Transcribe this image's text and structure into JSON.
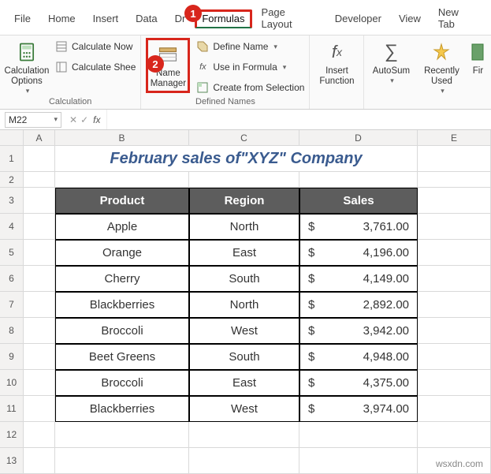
{
  "tabs": {
    "file": "File",
    "home": "Home",
    "insert": "Insert",
    "data": "Data",
    "draw": "Dr",
    "formulas": "Formulas",
    "page_layout": "Page Layout",
    "developer": "Developer",
    "view": "View",
    "new_tab": "New Tab"
  },
  "markers": {
    "m1": "1",
    "m2": "2"
  },
  "ribbon": {
    "calculation": {
      "options": "Calculation Options",
      "calc_now": "Calculate Now",
      "calc_sheet": "Calculate Shee",
      "group": "Calculation"
    },
    "defined_names": {
      "name_manager": "Name Manager",
      "define_name": "Define Name",
      "use_in_formula": "Use in Formula",
      "create_sel": "Create from Selection",
      "group": "Defined Names"
    },
    "insert_function": "Insert Function",
    "autosum": "AutoSum",
    "recently_used": "Recently Used",
    "fin": "Fir"
  },
  "namebox": {
    "ref": "M22",
    "fx": "fx"
  },
  "cols": {
    "A": "A",
    "B": "B",
    "C": "C",
    "D": "D",
    "E": "E"
  },
  "rows": [
    "1",
    "2",
    "3",
    "4",
    "5",
    "6",
    "7",
    "8",
    "9",
    "10",
    "11",
    "12",
    "13"
  ],
  "title": "February sales of\"XYZ\" Company",
  "headers": {
    "product": "Product",
    "region": "Region",
    "sales": "Sales"
  },
  "currency": "$",
  "data_rows": [
    {
      "product": "Apple",
      "region": "North",
      "sales": "3,761.00"
    },
    {
      "product": "Orange",
      "region": "East",
      "sales": "4,196.00"
    },
    {
      "product": "Cherry",
      "region": "South",
      "sales": "4,149.00"
    },
    {
      "product": "Blackberries",
      "region": "North",
      "sales": "2,892.00"
    },
    {
      "product": "Broccoli",
      "region": "West",
      "sales": "3,942.00"
    },
    {
      "product": "Beet Greens",
      "region": "South",
      "sales": "4,948.00"
    },
    {
      "product": "Broccoli",
      "region": "East",
      "sales": "4,375.00"
    },
    {
      "product": "Blackberries",
      "region": "West",
      "sales": "3,974.00"
    }
  ],
  "watermark": "wsxdn.com",
  "chart_data": {
    "type": "table",
    "title": "February sales of \"XYZ\" Company",
    "columns": [
      "Product",
      "Region",
      "Sales"
    ],
    "rows": [
      [
        "Apple",
        "North",
        3761.0
      ],
      [
        "Orange",
        "East",
        4196.0
      ],
      [
        "Cherry",
        "South",
        4149.0
      ],
      [
        "Blackberries",
        "North",
        2892.0
      ],
      [
        "Broccoli",
        "West",
        3942.0
      ],
      [
        "Beet Greens",
        "South",
        4948.0
      ],
      [
        "Broccoli",
        "East",
        4375.0
      ],
      [
        "Blackberries",
        "West",
        3974.0
      ]
    ]
  }
}
